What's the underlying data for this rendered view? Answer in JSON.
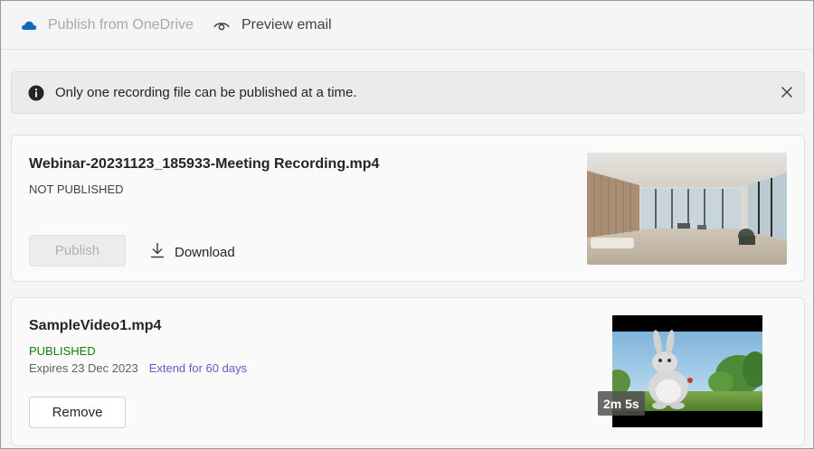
{
  "toolbar": {
    "publish_label": "Publish from OneDrive",
    "preview_label": "Preview email"
  },
  "banner": {
    "message": "Only one recording file can be published at a time."
  },
  "recordings": [
    {
      "title": "Webinar-20231123_185933-Meeting Recording.mp4",
      "status": "NOT PUBLISHED",
      "publish_label": "Publish",
      "download_label": "Download"
    },
    {
      "title": "SampleVideo1.mp4",
      "status": "PUBLISHED",
      "expires": "Expires 23 Dec 2023",
      "extend_label": "Extend for 60 days",
      "remove_label": "Remove",
      "duration": "2m 5s"
    }
  ],
  "colors": {
    "published": "#107c10",
    "link": "#5b5fc7",
    "onedrive": "#0f6cbd"
  },
  "icons": {
    "toolbar_publish": "onedrive-cloud-icon",
    "toolbar_preview": "eye-icon",
    "banner_info": "info-icon",
    "banner_close": "close-icon",
    "download": "download-icon"
  }
}
